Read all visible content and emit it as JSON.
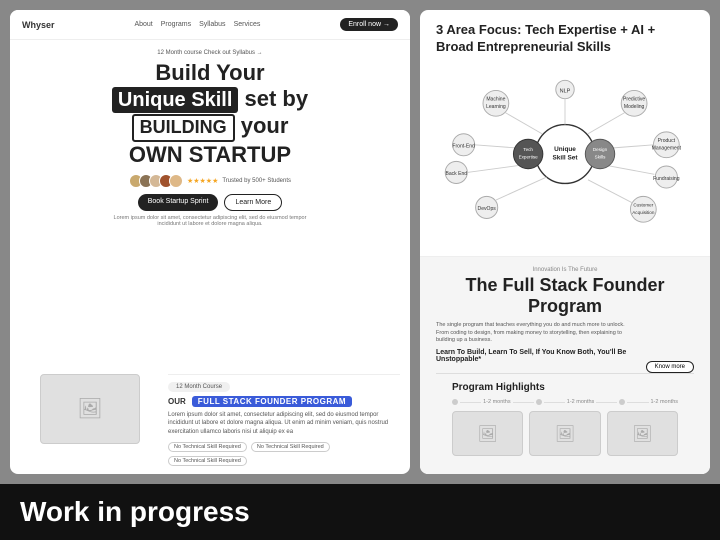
{
  "navbar": {
    "brand": "Whyser",
    "links": [
      "About",
      "Programs",
      "Syllabus",
      "Services"
    ],
    "cta": "Enroll now →"
  },
  "hero": {
    "badge": "12 Month course   Check out Syllabus →",
    "line1": "Build Your",
    "line2_highlight": "Unique Skill",
    "line2_rest": " set by",
    "line3_highlight": "BUILDING",
    "line3_rest": " your",
    "line4": "OWN STARTUP",
    "stars": "★★★★★",
    "rating_text": "Trusted by 500+ Students",
    "btn1": "Book Startup Sprint",
    "btn2": "Learn More",
    "small_text": "Lorem ipsum dolor sit amet, consectetur adipiscing elit, sed do eiusmod tempor incididunt ut labore et dolore magna aliqua."
  },
  "program": {
    "badge": "12 Month Course",
    "label": "OUR",
    "title": "FULL STACK FOUNDER PROGRAM",
    "desc": "Lorem ipsum dolor sit amet, consectetur adipiscing elit, sed do eiusmod tempor incididunt ut labore et dolore magna aliqua. Ut enim ad minim veniam, quis nostrud exercitation ullamco laboris nisi ut aliquip ex ea",
    "tags": [
      "No Technical Skill Required",
      "No Technical Skill Required",
      "No Technical Skill Required"
    ]
  },
  "right": {
    "area_focus_title": "3 Area Focus: Tech Expertise + AI + Broad Entrepreneurial Skills",
    "diagram": {
      "center_label": "Unique Skill Set",
      "nodes": [
        "NLP",
        "Machine Learning",
        "Predictive Modeling",
        "Front-End",
        "Product Management",
        "Back End",
        "Tech Expertise",
        "Fundraising",
        "DevOps",
        "Customer Acquisition",
        "Design Skills"
      ]
    },
    "innovation_label": "Innovation Is The Future",
    "full_stack_title": "The Full Stack Founder Program",
    "rb_desc": "The single program that teaches everything you do and much more to unlock. From coding to design, from making money to storytelling, then explaining to building up a business.",
    "rb_subtitle": "Learn To Build, Learn To Sell, If You Know Both, You'll Be Unstoppable*",
    "know_more": "Know more",
    "program_highlights": "Program Highlights",
    "timeline_labels": [
      "1-2 months",
      "1-2 months",
      "1-2 months"
    ]
  },
  "bottom_bar": {
    "text": "Work in progress"
  }
}
